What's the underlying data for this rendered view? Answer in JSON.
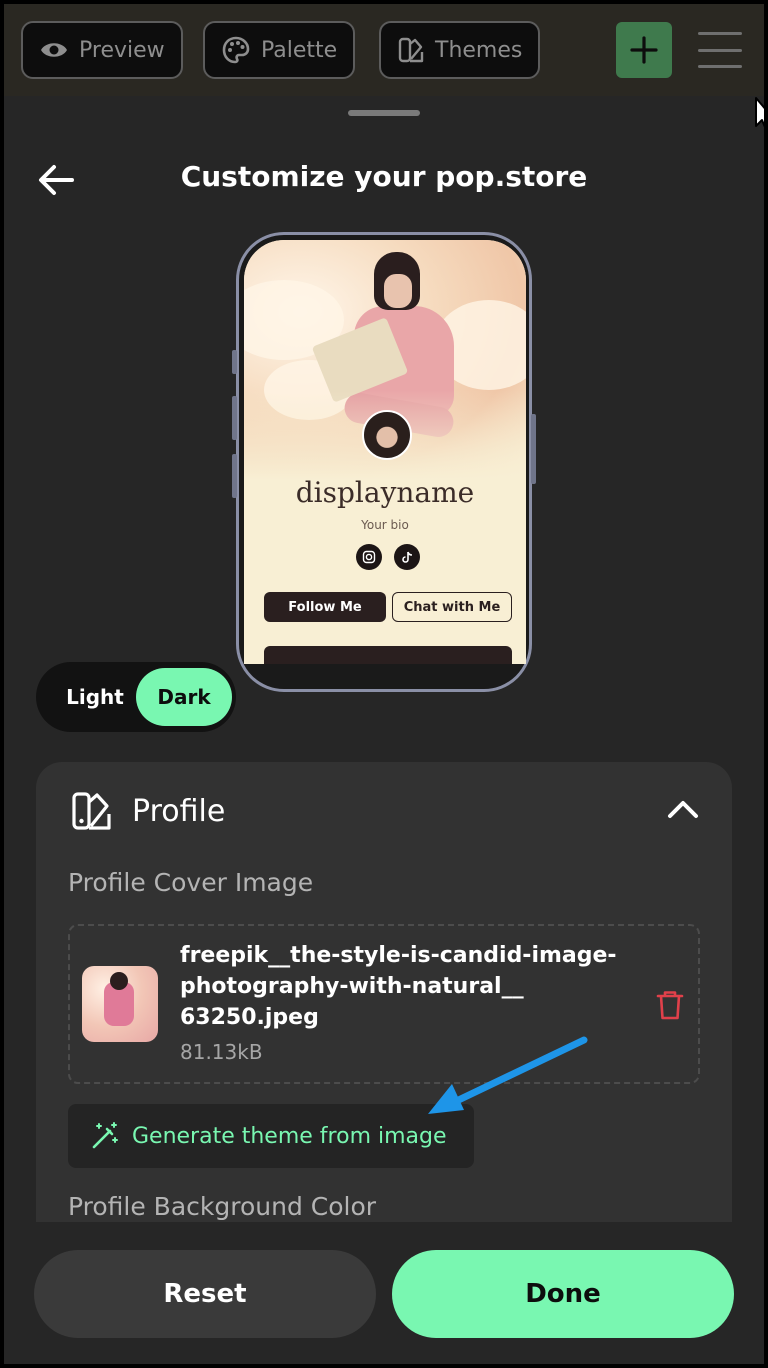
{
  "toolbar": {
    "preview_label": "Preview",
    "palette_label": "Palette",
    "themes_label": "Themes"
  },
  "header": {
    "title": "Customize your pop.store"
  },
  "phone_preview": {
    "display_name": "displayname",
    "bio": "Your bio",
    "follow_label": "Follow Me",
    "chat_label": "Chat with Me"
  },
  "mode_toggle": {
    "light_label": "Light",
    "dark_label": "Dark",
    "selected": "Dark"
  },
  "profile_panel": {
    "title": "Profile",
    "cover_label": "Profile Cover Image",
    "file_name": "freepik__the-style-is-candid-image-photography-with-natural__63250.jpeg",
    "file_size": "81.13kB",
    "generate_label": "Generate theme from image",
    "background_label": "Profile Background Color"
  },
  "actions": {
    "reset_label": "Reset",
    "done_label": "Done"
  },
  "colors": {
    "accent": "#79f7b1",
    "delete": "#e0404a",
    "annotation": "#1e95e8",
    "panel": "#323232"
  }
}
